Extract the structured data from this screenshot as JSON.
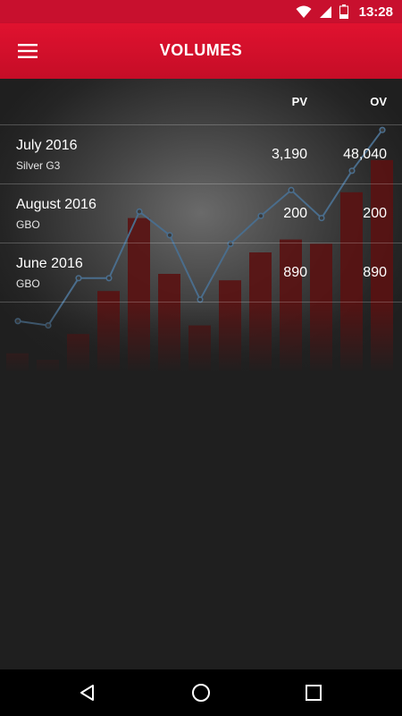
{
  "status_bar": {
    "time": "13:28",
    "icons": [
      "wifi-icon",
      "signal-icon",
      "battery-icon"
    ]
  },
  "app_bar": {
    "title": "VOLUMES",
    "menu_icon": "hamburger-menu-icon"
  },
  "table": {
    "columns": {
      "pv": "PV",
      "ov": "OV"
    },
    "rows": [
      {
        "period": "July 2016",
        "rank": "Silver G3",
        "pv": "3,190",
        "ov": "48,040"
      },
      {
        "period": "August 2016",
        "rank": "GBO",
        "pv": "200",
        "ov": "200"
      },
      {
        "period": "June 2016",
        "rank": "GBO",
        "pv": "890",
        "ov": "890"
      }
    ]
  },
  "chart_data": {
    "type": "bar",
    "bar_values": [
      0.08,
      0.05,
      0.17,
      0.37,
      0.71,
      0.45,
      0.21,
      0.42,
      0.55,
      0.61,
      0.59,
      0.83,
      0.98
    ],
    "line_values": [
      0.23,
      0.21,
      0.43,
      0.43,
      0.74,
      0.63,
      0.33,
      0.59,
      0.72,
      0.84,
      0.71,
      0.93,
      1.12
    ],
    "colors": {
      "bars": "#5a1212",
      "line": "#4a6d8c",
      "accent": "#d0112b"
    }
  },
  "nav_bar": {
    "icons": [
      "back-icon",
      "home-icon",
      "recents-icon"
    ]
  }
}
